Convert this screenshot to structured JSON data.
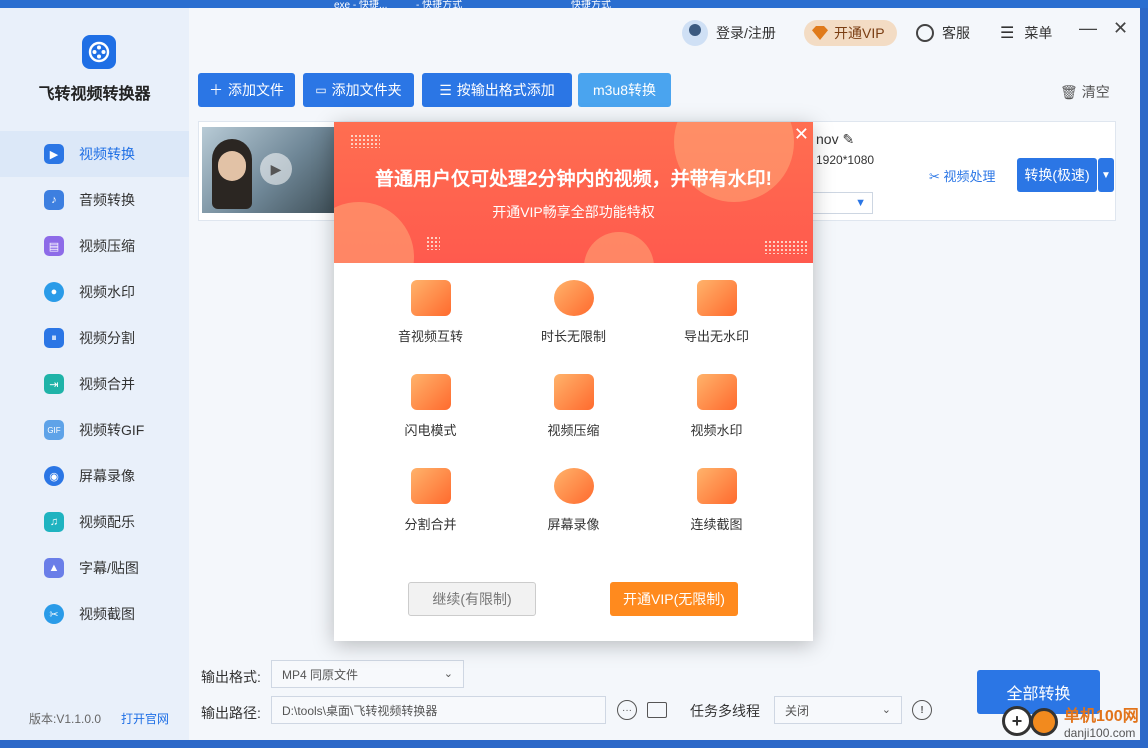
{
  "taskbar": {
    "items": [
      "exe - 快捷...",
      "- 快捷方式",
      "快捷方式"
    ]
  },
  "app": {
    "name": "飞转视频转换器",
    "version": "版本:V1.1.0.0",
    "website": "打开官网"
  },
  "sidebar": {
    "items": [
      {
        "label": "视频转换",
        "icon": "video-convert-icon",
        "color": "#2b76e5"
      },
      {
        "label": "音频转换",
        "icon": "audio-icon",
        "color": "#3d7fe0"
      },
      {
        "label": "视频压缩",
        "icon": "compress-icon",
        "color": "#8d6be8"
      },
      {
        "label": "视频水印",
        "icon": "watermark-icon",
        "color": "#2a9be8"
      },
      {
        "label": "视频分割",
        "icon": "split-icon",
        "color": "#2b76e5"
      },
      {
        "label": "视频合并",
        "icon": "merge-icon",
        "color": "#1fb3a8"
      },
      {
        "label": "视频转GIF",
        "icon": "gif-icon",
        "color": "#5fa3e8"
      },
      {
        "label": "屏幕录像",
        "icon": "record-icon",
        "color": "#2b76e5"
      },
      {
        "label": "视频配乐",
        "icon": "music-icon",
        "color": "#1fb3c0"
      },
      {
        "label": "字幕/贴图",
        "icon": "image-icon",
        "color": "#6a7ee8"
      },
      {
        "label": "视频截图",
        "icon": "scissors-icon",
        "color": "#2a9be8"
      }
    ]
  },
  "header": {
    "login": "登录/注册",
    "vip": "开通VIP",
    "service": "客服",
    "menu": "菜单"
  },
  "toolbar": {
    "add_file": "添加文件",
    "add_folder": "添加文件夹",
    "add_by_format": "按输出格式添加",
    "m3u8": "m3u8转换",
    "clear": "清空"
  },
  "file": {
    "name_suffix": "nov",
    "resolution": "1920*1080",
    "process": "视频处理",
    "convert": "转换(极速)"
  },
  "bottom": {
    "format_label": "输出格式:",
    "format_value": "MP4  同原文件",
    "path_label": "输出路径:",
    "path_value": "D:\\tools\\桌面\\飞转视频转换器",
    "thread_label": "任务多线程",
    "thread_value": "关闭",
    "convert_all": "全部转换"
  },
  "watermark": {
    "site": "单机100网",
    "url": "danji100.com"
  },
  "modal": {
    "title": "普通用户仅可处理2分钟内的视频，并带有水印!",
    "subtitle": "开通VIP畅享全部功能特权",
    "features": [
      "音视频互转",
      "时长无限制",
      "导出无水印",
      "闪电模式",
      "视频压缩",
      "视频水印",
      "分割合并",
      "屏幕录像",
      "连续截图"
    ],
    "continue_btn": "继续(有限制)",
    "vip_btn": "开通VIP(无限制)"
  }
}
